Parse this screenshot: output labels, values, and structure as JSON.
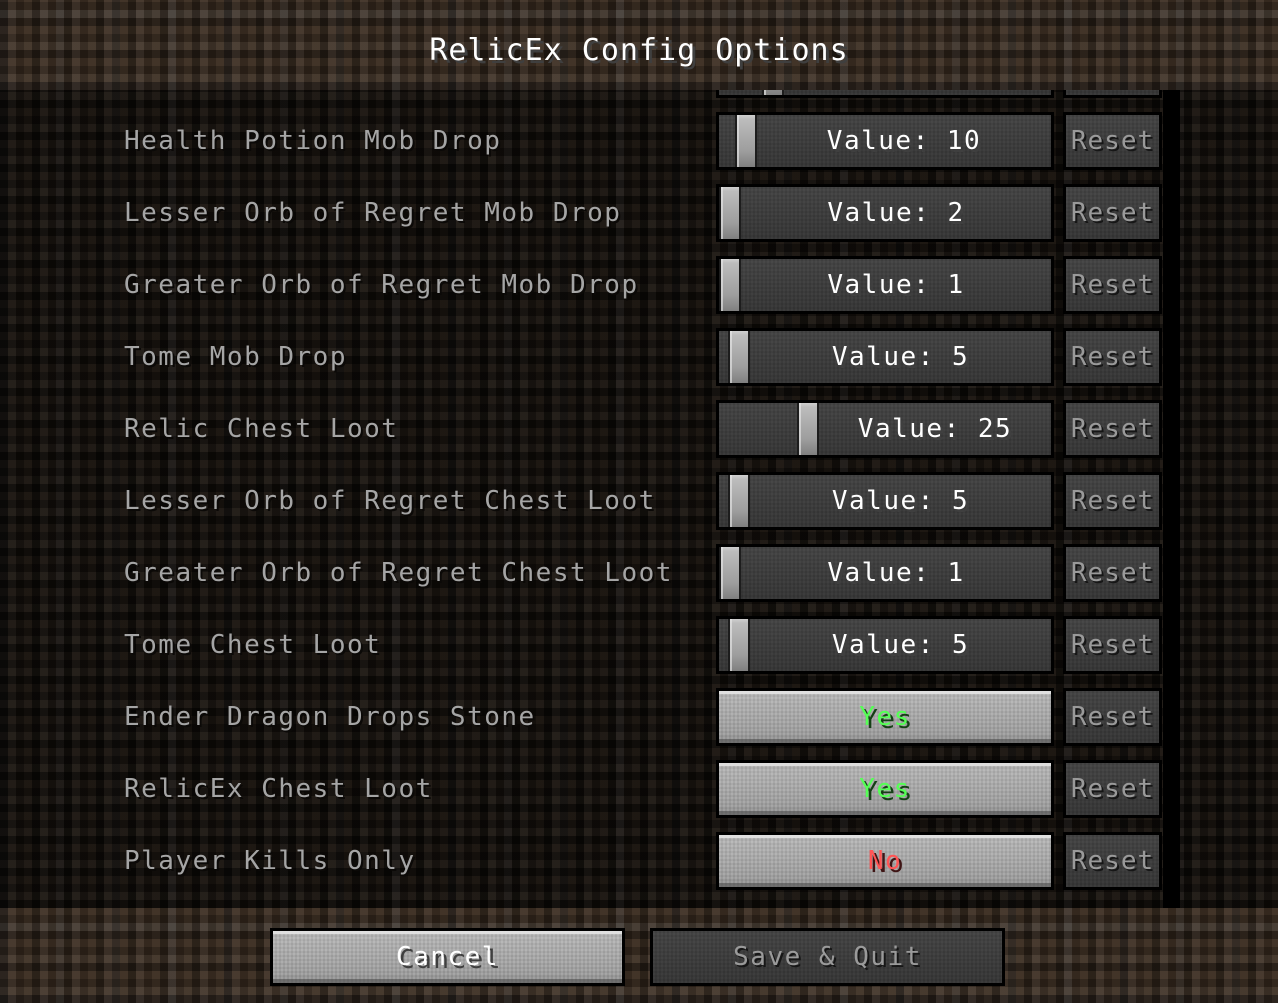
{
  "window": {
    "title": "RelicEx Config Options"
  },
  "colors": {
    "accent_yes": "#55FF55",
    "accent_no": "#FF5555",
    "label_gray": "#A5A5A5",
    "value_white": "#FFFFFF",
    "disabled_gray": "#9A9A9A",
    "dirt_header": "#3B2D21",
    "dirt_list": "#18120D"
  },
  "list": {
    "scroll_clipped_top_row": true,
    "reset_label": "Reset",
    "rows": [
      {
        "label": "",
        "type": "slider",
        "value_text": "",
        "thumb_percent": 14,
        "reset_enabled": false,
        "partial": true
      },
      {
        "label": "Health Potion Mob Drop",
        "type": "slider",
        "value_text": "Value: 10",
        "thumb_percent": 5,
        "reset_enabled": false,
        "partial": false
      },
      {
        "label": "Lesser Orb of Regret Mob Drop",
        "type": "slider",
        "value_text": "Value: 2",
        "thumb_percent": 0,
        "reset_enabled": false,
        "partial": false
      },
      {
        "label": "Greater Orb of Regret Mob Drop",
        "type": "slider",
        "value_text": "Value: 1",
        "thumb_percent": 0,
        "reset_enabled": false,
        "partial": false
      },
      {
        "label": "Tome Mob Drop",
        "type": "slider",
        "value_text": "Value: 5",
        "thumb_percent": 3,
        "reset_enabled": false,
        "partial": false
      },
      {
        "label": "Relic Chest Loot",
        "type": "slider",
        "value_text": "Value: 25",
        "thumb_percent": 25,
        "reset_enabled": false,
        "partial": false
      },
      {
        "label": "Lesser Orb of Regret Chest Loot",
        "type": "slider",
        "value_text": "Value: 5",
        "thumb_percent": 3,
        "reset_enabled": false,
        "partial": false
      },
      {
        "label": "Greater Orb of Regret Chest Loot",
        "type": "slider",
        "value_text": "Value: 1",
        "thumb_percent": 0,
        "reset_enabled": false,
        "partial": false
      },
      {
        "label": "Tome Chest Loot",
        "type": "slider",
        "value_text": "Value: 5",
        "thumb_percent": 3,
        "reset_enabled": false,
        "partial": false
      },
      {
        "label": "Ender Dragon Drops Stone",
        "type": "toggle",
        "value_text": "Yes",
        "reset_enabled": false,
        "partial": false
      },
      {
        "label": "RelicEx Chest Loot",
        "type": "toggle",
        "value_text": "Yes",
        "reset_enabled": false,
        "partial": false
      },
      {
        "label": "Player Kills Only",
        "type": "toggle",
        "value_text": "No",
        "reset_enabled": false,
        "partial": false
      }
    ]
  },
  "footer": {
    "cancel_label": "Cancel",
    "save_label": "Save & Quit",
    "cancel_enabled": true,
    "save_enabled": false
  }
}
